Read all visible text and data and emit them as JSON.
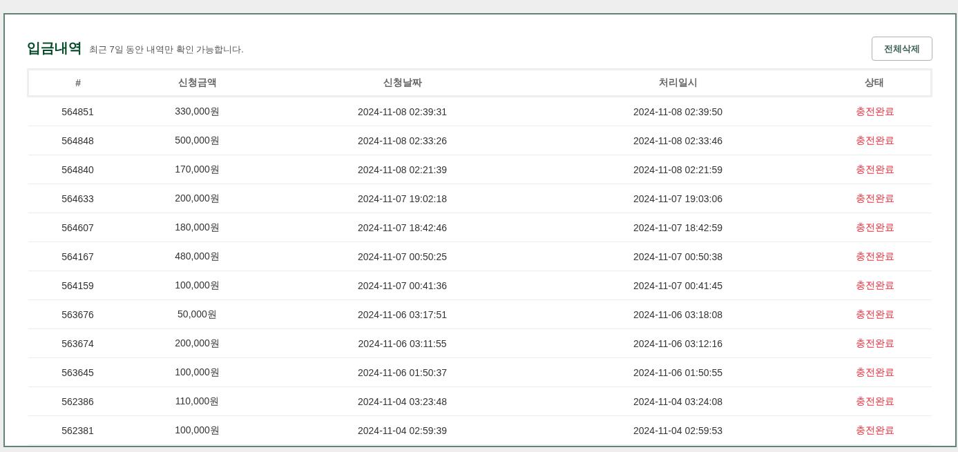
{
  "header": {
    "title": "입금내역",
    "subtitle": "최근 7일 동안 내역만 확인 가능합니다.",
    "delete_all_button": "전체삭제"
  },
  "table": {
    "columns": [
      "#",
      "신청금액",
      "신청날짜",
      "처리일시",
      "상태"
    ],
    "rows": [
      [
        "564851",
        "330,000원",
        "2024-11-08 02:39:31",
        "2024-11-08 02:39:50",
        "충전완료"
      ],
      [
        "564848",
        "500,000원",
        "2024-11-08 02:33:26",
        "2024-11-08 02:33:46",
        "충전완료"
      ],
      [
        "564840",
        "170,000원",
        "2024-11-08 02:21:39",
        "2024-11-08 02:21:59",
        "충전완료"
      ],
      [
        "564633",
        "200,000원",
        "2024-11-07 19:02:18",
        "2024-11-07 19:03:06",
        "충전완료"
      ],
      [
        "564607",
        "180,000원",
        "2024-11-07 18:42:46",
        "2024-11-07 18:42:59",
        "충전완료"
      ],
      [
        "564167",
        "480,000원",
        "2024-11-07 00:50:25",
        "2024-11-07 00:50:38",
        "충전완료"
      ],
      [
        "564159",
        "100,000원",
        "2024-11-07 00:41:36",
        "2024-11-07 00:41:45",
        "충전완료"
      ],
      [
        "563676",
        "50,000원",
        "2024-11-06 03:17:51",
        "2024-11-06 03:18:08",
        "충전완료"
      ],
      [
        "563674",
        "200,000원",
        "2024-11-06 03:11:55",
        "2024-11-06 03:12:16",
        "충전완료"
      ],
      [
        "563645",
        "100,000원",
        "2024-11-06 01:50:37",
        "2024-11-06 01:50:55",
        "충전완료"
      ],
      [
        "562386",
        "110,000원",
        "2024-11-04 03:23:48",
        "2024-11-04 03:24:08",
        "충전완료"
      ],
      [
        "562381",
        "100,000원",
        "2024-11-04 02:59:39",
        "2024-11-04 02:59:53",
        "충전완료"
      ]
    ]
  }
}
